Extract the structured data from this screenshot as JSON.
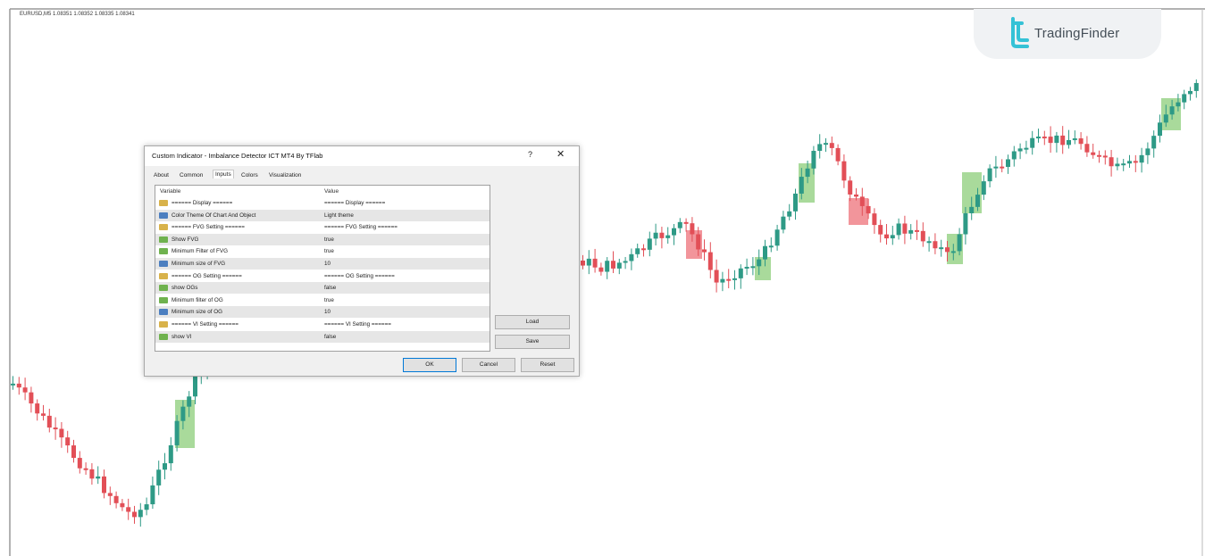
{
  "chart": {
    "symbol_info": "EURUSD,M5  1.08351 1.08352 1.08335 1.08341",
    "colors": {
      "bull": "#2e9a86",
      "bear": "#e24f57",
      "fvg_zone": "#9ad48a",
      "bear_zone": "#f0828a"
    },
    "candle_close_series": []
  },
  "logo": {
    "text": "TradingFinder",
    "icon": "tradingfinder-logo-icon"
  },
  "dialog": {
    "title": "Custom Indicator - Imbalance Detector ICT MT4 By TFlab",
    "help_label": "?",
    "close_label": "✕",
    "tabs": [
      {
        "label": "About",
        "active": false
      },
      {
        "label": "Common",
        "active": false
      },
      {
        "label": "Inputs",
        "active": true
      },
      {
        "label": "Colors",
        "active": false
      },
      {
        "label": "Visualization",
        "active": false
      }
    ],
    "columns": {
      "variable": "Variable",
      "value": "Value"
    },
    "rows": [
      {
        "variable": "====== Display ======",
        "value": "====== Display ======",
        "icon": "ab-string-icon"
      },
      {
        "variable": "Color Theme Of Chart And Object",
        "value": "Light theme",
        "icon": "enum-icon"
      },
      {
        "variable": "====== FVG Setting ======",
        "value": "====== FVG Setting ======",
        "icon": "ab-string-icon"
      },
      {
        "variable": "Show FVG",
        "value": "true",
        "icon": "bool-icon"
      },
      {
        "variable": "Minimum Filter of FVG",
        "value": "true",
        "icon": "bool-icon"
      },
      {
        "variable": "Minimum size of FVG",
        "value": "10",
        "icon": "int-icon"
      },
      {
        "variable": "====== OG Setting ======",
        "value": "====== OG Setting ======",
        "icon": "ab-string-icon"
      },
      {
        "variable": "show OGs",
        "value": "false",
        "icon": "bool-icon"
      },
      {
        "variable": "Minimum filter of OG",
        "value": "true",
        "icon": "bool-icon"
      },
      {
        "variable": "Minimum size of OG",
        "value": "10",
        "icon": "int-icon"
      },
      {
        "variable": "====== VI Setting ======",
        "value": "====== VI Setting ======",
        "icon": "ab-string-icon"
      },
      {
        "variable": "show VI",
        "value": "false",
        "icon": "bool-icon"
      }
    ],
    "buttons": {
      "load": "Load",
      "save": "Save",
      "ok": "OK",
      "cancel": "Cancel",
      "reset": "Reset"
    }
  }
}
